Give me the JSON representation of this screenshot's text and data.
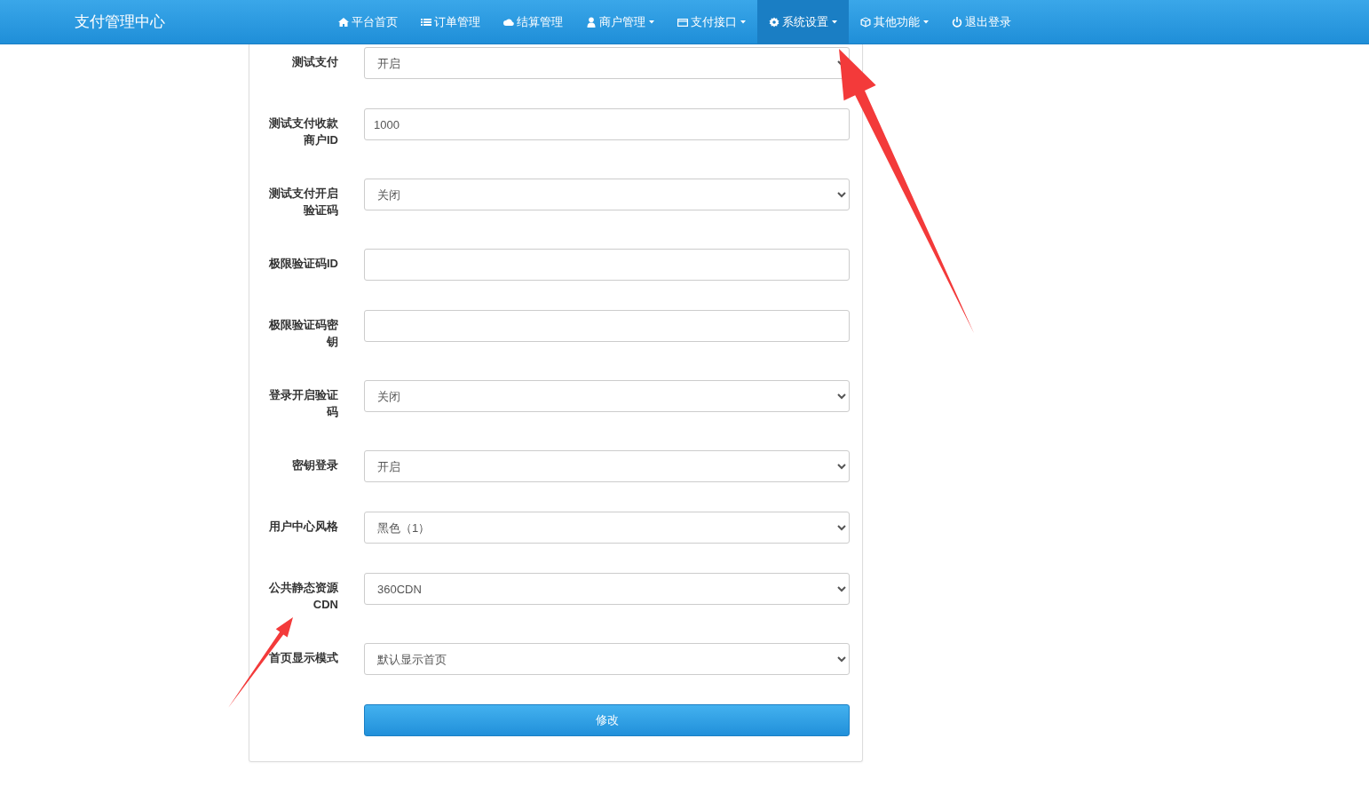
{
  "navbar": {
    "brand": "支付管理中心",
    "items": [
      {
        "label": "平台首页",
        "has_menu": false,
        "selected": false
      },
      {
        "label": "订单管理",
        "has_menu": false,
        "selected": false
      },
      {
        "label": "结算管理",
        "has_menu": false,
        "selected": false
      },
      {
        "label": "商户管理",
        "has_menu": true,
        "selected": false
      },
      {
        "label": "支付接口",
        "has_menu": true,
        "selected": false
      },
      {
        "label": "系统设置",
        "has_menu": true,
        "selected": true
      },
      {
        "label": "其他功能",
        "has_menu": true,
        "selected": false
      },
      {
        "label": "退出登录",
        "has_menu": false,
        "selected": false
      }
    ]
  },
  "form": {
    "fields": [
      {
        "kind": "select",
        "label": "测试支付",
        "value": "开启"
      },
      {
        "kind": "input",
        "label": "测试支付收款商户ID",
        "value": "1000"
      },
      {
        "kind": "select",
        "label": "测试支付开启验证码",
        "value": "关闭"
      },
      {
        "kind": "input",
        "label": "极限验证码ID"
      },
      {
        "kind": "input",
        "label": "极限验证码密钥"
      },
      {
        "kind": "select",
        "label": "登录开启验证码",
        "value": "关闭"
      },
      {
        "kind": "select",
        "label": "密钥登录",
        "value": "开启"
      },
      {
        "kind": "select",
        "label": "用户中心风格",
        "value": "黑色（1）"
      },
      {
        "kind": "select",
        "label": "公共静态资源CDN",
        "value": "360CDN"
      },
      {
        "kind": "select",
        "label": "首页显示模式",
        "value": "默认显示首页"
      }
    ],
    "submit": "修改"
  }
}
